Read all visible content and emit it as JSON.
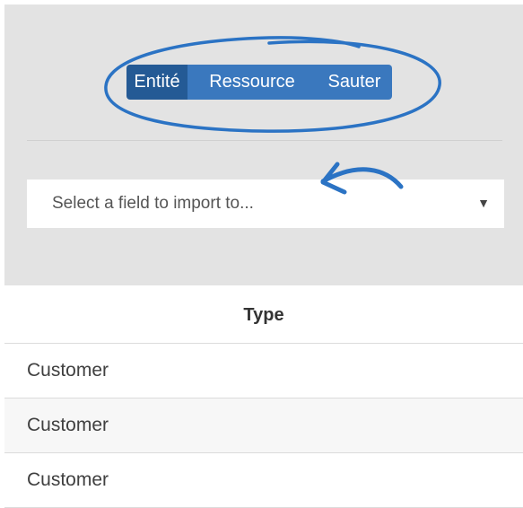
{
  "toolbar": {
    "buttons": [
      {
        "label": "Entité",
        "active": true
      },
      {
        "label": "Ressource",
        "active": false
      },
      {
        "label": "Sauter",
        "active": false
      }
    ]
  },
  "field_select": {
    "placeholder": "Select a field to import to...",
    "caret": "▼"
  },
  "table": {
    "header": "Type",
    "rows": [
      "Customer",
      "Customer",
      "Customer"
    ]
  },
  "colors": {
    "accent": "#3a78be",
    "accent_active": "#245a95",
    "annotation": "#2b73c4",
    "panel_bg": "#e3e3e3"
  }
}
